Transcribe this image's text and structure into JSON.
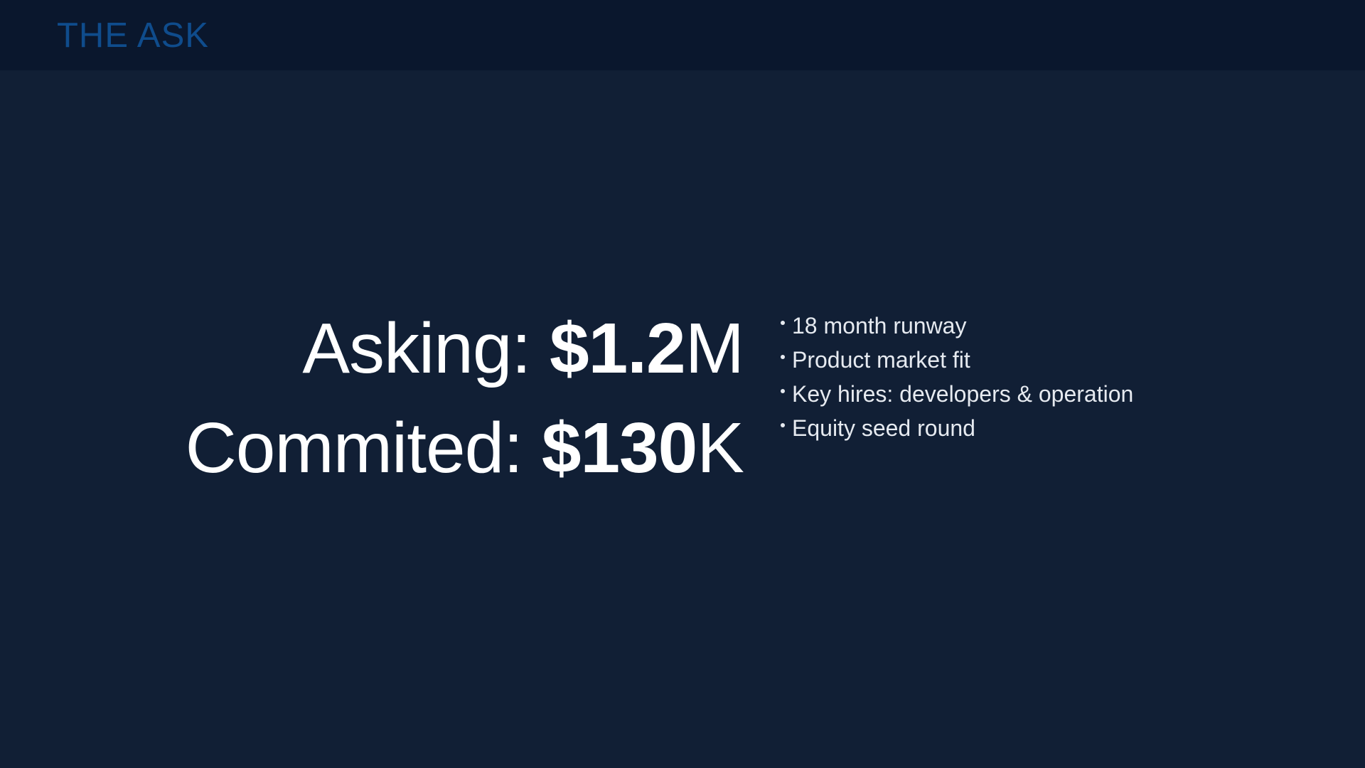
{
  "header": {
    "title": "THE ASK"
  },
  "amounts": {
    "asking": {
      "label": "Asking: ",
      "value": "$1.2",
      "unit": "M"
    },
    "committed": {
      "label": "Commited: ",
      "value": "$130",
      "unit": "K"
    }
  },
  "bullets": [
    "18 month runway",
    "Product market fit",
    "Key hires: developers & operation",
    "Equity seed round"
  ],
  "colors": {
    "background": "#111f35",
    "header_bar": "#0a172d",
    "title_accent": "#0f4c8c",
    "text": "#ffffff"
  }
}
